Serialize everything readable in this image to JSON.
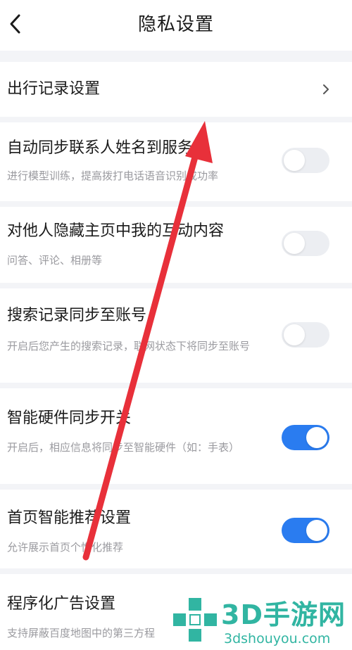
{
  "header": {
    "title": "隐私设置",
    "back_icon": "chevron-left-icon"
  },
  "rows": [
    {
      "label": "出行记录设置",
      "icon": "chevron-right-icon"
    },
    {
      "label": "自动同步联系人姓名到服务端",
      "desc": "进行模型训练，提高拨打电话语音识别成功率",
      "toggle": "off"
    },
    {
      "label": "对他人隐藏主页中我的互动内容",
      "desc": "问答、评论、相册等",
      "toggle": "off"
    },
    {
      "label": "搜索记录同步至账号",
      "desc": "开启后您产生的搜索记录，联网状态下将同步至账号",
      "toggle": "off"
    },
    {
      "label": "智能硬件同步开关",
      "desc": "开启后，相应信息将同步至智能硬件（如：手表）",
      "toggle": "on"
    },
    {
      "label": "首页智能推荐设置",
      "desc": "允许展示首页个性化推荐",
      "toggle": "on"
    },
    {
      "label": "程序化广告设置",
      "desc": "支持屏蔽百度地图中的第三方程"
    }
  ],
  "colors": {
    "toggle_on": "#2a7cf0",
    "toggle_off": "#eceef2",
    "arrow": "#e8303a",
    "watermark": "#31b5a2"
  },
  "watermark": {
    "main": "3D手游网",
    "sub": "3dshouyou.com"
  }
}
